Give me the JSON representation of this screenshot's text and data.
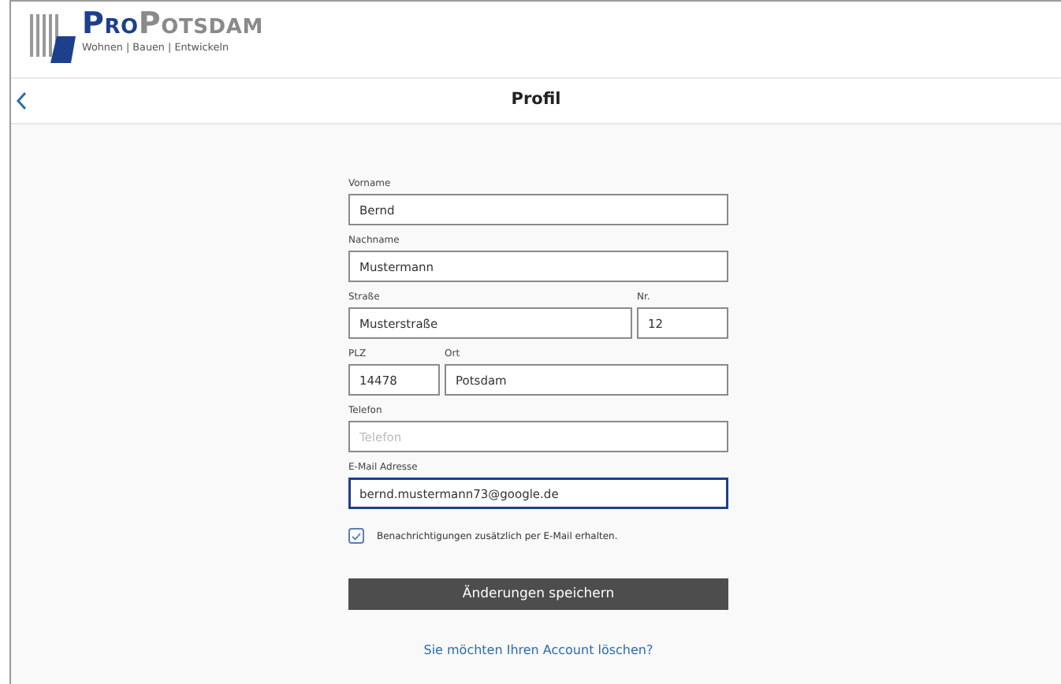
{
  "logo": {
    "brand_primary": "Pro",
    "brand_secondary": "Potsdam",
    "tagline": "Wohnen | Bauen | Entwickeln"
  },
  "nav": {
    "title": "Profil"
  },
  "form": {
    "groups": [
      {
        "rows": [
          [
            {
              "label": "Vorname",
              "value": "Bernd",
              "focused": false
            }
          ]
        ]
      },
      {
        "rows": [
          [
            {
              "label": "Nachname",
              "value": "Mustermann",
              "focused": false
            }
          ]
        ]
      },
      {
        "rows": [
          [
            {
              "label": "Straße",
              "value": "Musterstraße",
              "focused": false
            },
            {
              "label": "Nr.",
              "value": "12",
              "focused": false
            }
          ]
        ]
      },
      {
        "rows": [
          [
            {
              "label": "PLZ",
              "value": "14478",
              "focused": false
            },
            {
              "label": "Ort",
              "value": "Potsdam",
              "focused": false
            }
          ]
        ]
      },
      {
        "rows": [
          [
            {
              "label": "Telefon",
              "placeholder": "Telefon",
              "focused": false
            }
          ]
        ]
      },
      {
        "rows": [
          [
            {
              "label": "E-Mail Adresse",
              "value": "bernd.mustermann73@google.de",
              "focused": true
            }
          ]
        ]
      }
    ],
    "checkbox": {
      "label": "Benachrichtigungen zusätzlich per E-Mail erhalten.",
      "checked": true
    },
    "submit": "Änderungen speichern",
    "delete_link": "Sie möchten Ihren Account löschen?"
  }
}
